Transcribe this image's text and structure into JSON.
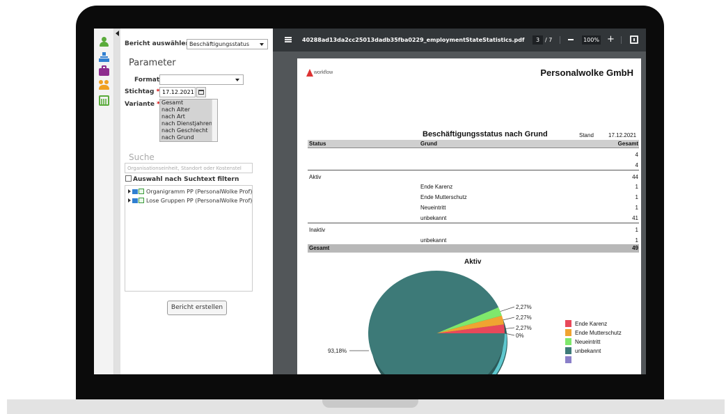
{
  "app": {
    "report_select_label": "Bericht auswählen",
    "report_select_value": "Beschäftigungsstatus"
  },
  "params": {
    "heading": "Parameter",
    "format_label": "Format",
    "format_value": "",
    "date_label": "Stichtag",
    "date_value": "17.12.2021",
    "variant_label": "Variante",
    "variant_options": [
      "Gesamt",
      "nach Alter",
      "nach Art",
      "nach Dienstjahren",
      "nach Geschlecht",
      "nach Grund"
    ],
    "required_mark": "*"
  },
  "search": {
    "heading": "Suche",
    "placeholder": "Organisationseinheit, Standort oder Kostenstel",
    "filter_checkbox_label": "Auswahl nach Suchtext filtern",
    "tree_items": [
      "Organigramm PP (PersonalWolke Prof)",
      "Lose Gruppen PP (PersonalWolke Prof)"
    ]
  },
  "create_button_label": "Bericht erstellen",
  "viewer": {
    "filename": "40288ad13da2cc25013dadb35fba0229_employmentStateStatistics.pdf",
    "page_current": "3",
    "page_total": "/ 7",
    "zoom": "100%",
    "plus": "+"
  },
  "report": {
    "logo_text": "workflow",
    "company": "Personalwolke GmbH",
    "title": "Beschäftigungsstatus nach Grund",
    "stand_label": "Stand",
    "stand_date": "17.12.2021",
    "columns": [
      "Status",
      "Grund",
      "Gesamt"
    ],
    "rows": [
      {
        "status": "",
        "grund": "",
        "gesamt": "4"
      },
      {
        "status": "",
        "grund": "",
        "gesamt": "4"
      },
      {
        "status": "Aktiv",
        "grund": "",
        "gesamt": "44"
      },
      {
        "status": "",
        "grund": "Ende Karenz",
        "gesamt": "1"
      },
      {
        "status": "",
        "grund": "Ende Mutterschutz",
        "gesamt": "1"
      },
      {
        "status": "",
        "grund": "Neueintritt",
        "gesamt": "1"
      },
      {
        "status": "",
        "grund": "unbekannt",
        "gesamt": "41"
      },
      {
        "status": "Inaktiv",
        "grund": "",
        "gesamt": "1"
      },
      {
        "status": "",
        "grund": "unbekannt",
        "gesamt": "1"
      }
    ],
    "total_label": "Gesamt",
    "total_value": "49"
  },
  "chart_data": {
    "type": "pie",
    "title": "Aktiv",
    "categories": [
      "Ende Karenz",
      "Ende Mutterschutz",
      "Neueintritt",
      "unbekannt",
      ""
    ],
    "values": [
      2.27,
      2.27,
      2.27,
      93.18,
      0
    ],
    "labels": [
      "2,27%",
      "2,27%",
      "2,27%",
      "93,18%",
      "0%"
    ],
    "colors": [
      "#e8485a",
      "#f0a431",
      "#7fe86c",
      "#3d7a78",
      "#8a7fc9"
    ],
    "legend": "right"
  }
}
